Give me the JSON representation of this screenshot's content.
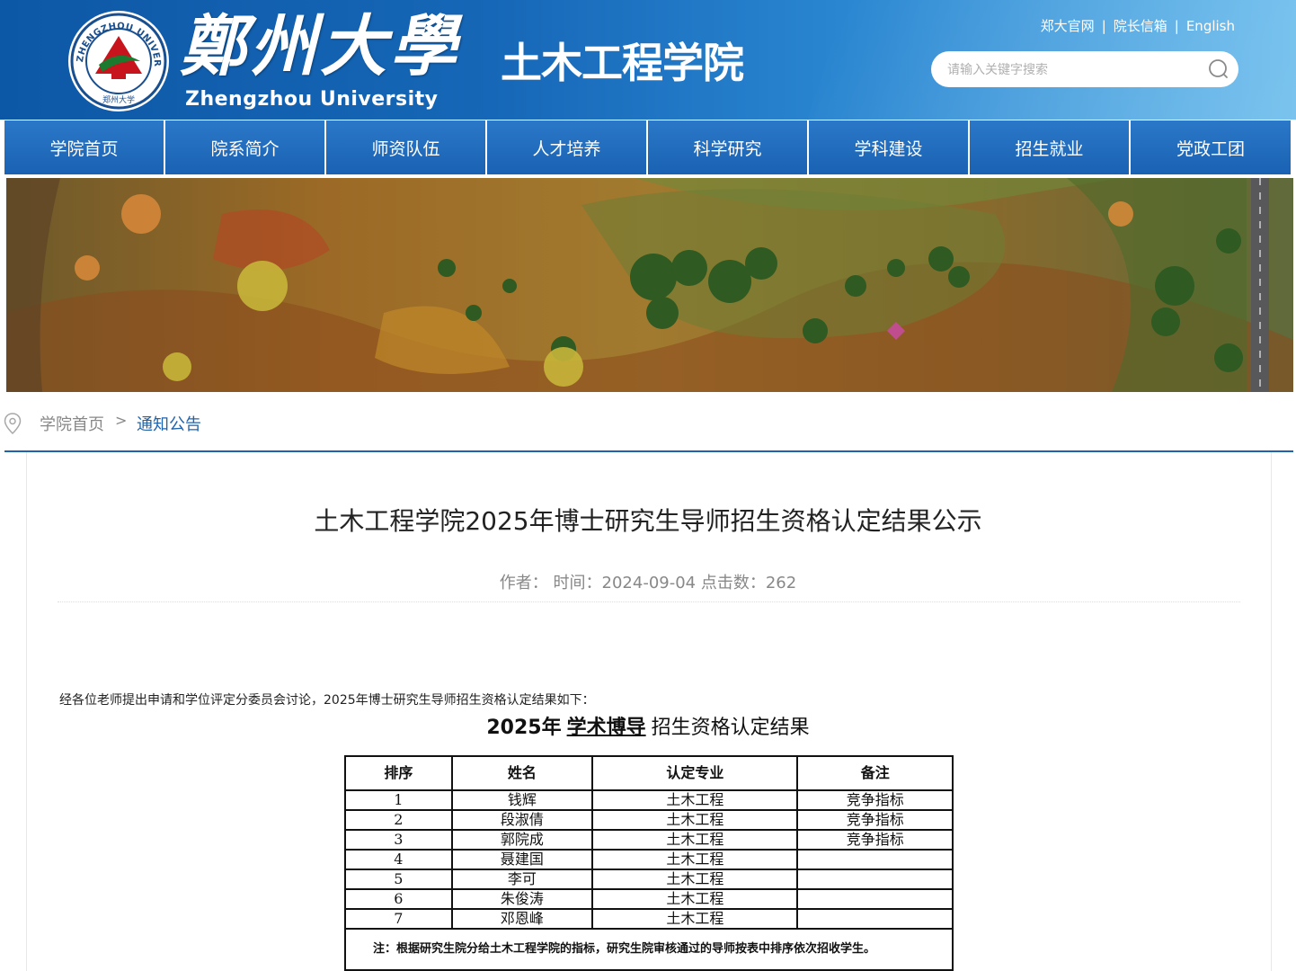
{
  "header": {
    "university_cn": "鄭州大學",
    "university_en": "Zhengzhou University",
    "school_name": "土木工程学院",
    "emblem_ring_text": "ZHENGZHOU UNIVERSITY",
    "emblem_bottom_text": "郑州大学",
    "links": [
      "郑大官网",
      "院长信箱",
      "English"
    ],
    "search_placeholder": "请输入关键字搜索"
  },
  "nav": {
    "items": [
      "学院首页",
      "院系简介",
      "师资队伍",
      "人才培养",
      "科学研究",
      "学科建设",
      "招生就业",
      "党政工团"
    ]
  },
  "breadcrumb": {
    "home": "学院首页",
    "separator": ">",
    "current": "通知公告"
  },
  "article": {
    "title": "土木工程学院2025年博士研究生导师招生资格认定结果公示",
    "meta": "作者：  时间：2024-09-04 点击数：262",
    "intro": "经各位老师提出申请和学位评定分委员会讨论，2025年博士研究生导师招生资格认定结果如下：",
    "table_title": {
      "year": "2025年",
      "kind": "学术博导",
      "rest": "招生资格认定结果"
    },
    "table": {
      "headers": [
        "排序",
        "姓名",
        "认定专业",
        "备注"
      ],
      "rows": [
        [
          "1",
          "钱辉",
          "土木工程",
          "竞争指标"
        ],
        [
          "2",
          "段淑倩",
          "土木工程",
          "竞争指标"
        ],
        [
          "3",
          "郭院成",
          "土木工程",
          "竞争指标"
        ],
        [
          "4",
          "聂建国",
          "土木工程",
          ""
        ],
        [
          "5",
          "李可",
          "土木工程",
          ""
        ],
        [
          "6",
          "朱俊涛",
          "土木工程",
          ""
        ],
        [
          "7",
          "邓恩峰",
          "土木工程",
          ""
        ]
      ],
      "note": "注：根据研究生院分给土木工程学院的指标，研究生院审核通过的导师按表中排序依次招收学生。"
    }
  },
  "colors": {
    "header_blue": "#1667b7",
    "nav_blue": "#1a62b3",
    "link_blue": "#1f63ad"
  }
}
